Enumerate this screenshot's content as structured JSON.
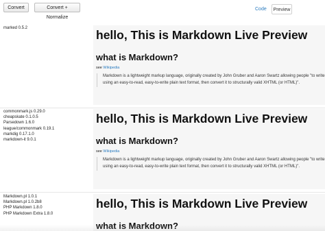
{
  "toolbar": {
    "convert_label": "Convert",
    "convert_normalize_label": "Convert + Normalize",
    "tab_code_label": "Code",
    "tab_preview_label": "Preview"
  },
  "groups": [
    {
      "libraries": [
        "marked 0.5.2"
      ],
      "preview": {
        "h1": "hello, This is Markdown Live Preview",
        "h2": "what is Markdown?",
        "see_prefix": "see ",
        "see_link": "Wikipedia",
        "quote": "Markdown is a lightweight markup language, originally created by John Gruber and Aaron Swartz allowing people \"to write using an easy-to-read, easy-to-write plain text format, then convert it to structurally valid XHTML (or HTML)\"."
      }
    },
    {
      "libraries": [
        "commonmark.js 0.29.0",
        "cheapskate 0.1.0.5",
        "Parsedown 1.6.0",
        "league/commonmark 0.19.1",
        "markdig 0.17.1.0",
        "markdown-it 9.0.1"
      ],
      "preview": {
        "h1": "hello, This is Markdown Live Preview",
        "h2": "what is Markdown?",
        "see_prefix": "see ",
        "see_link": "Wikipedia",
        "quote": "Markdown is a lightweight markup language, originally created by John Gruber and Aaron Swartz allowing people \"to write using an easy-to-read, easy-to-write plain text format, then convert it to structurally valid XHTML (or HTML)\"."
      }
    },
    {
      "libraries": [
        "Markdown.pl 1.0.1",
        "Markdown.pl 1.0.2b8",
        "PHP Markdown 1.8.0",
        "PHP Markdown Extra 1.8.0"
      ],
      "preview": {
        "h1": "hello, This is Markdown Live Preview",
        "h2": "what is Markdown?"
      }
    }
  ]
}
